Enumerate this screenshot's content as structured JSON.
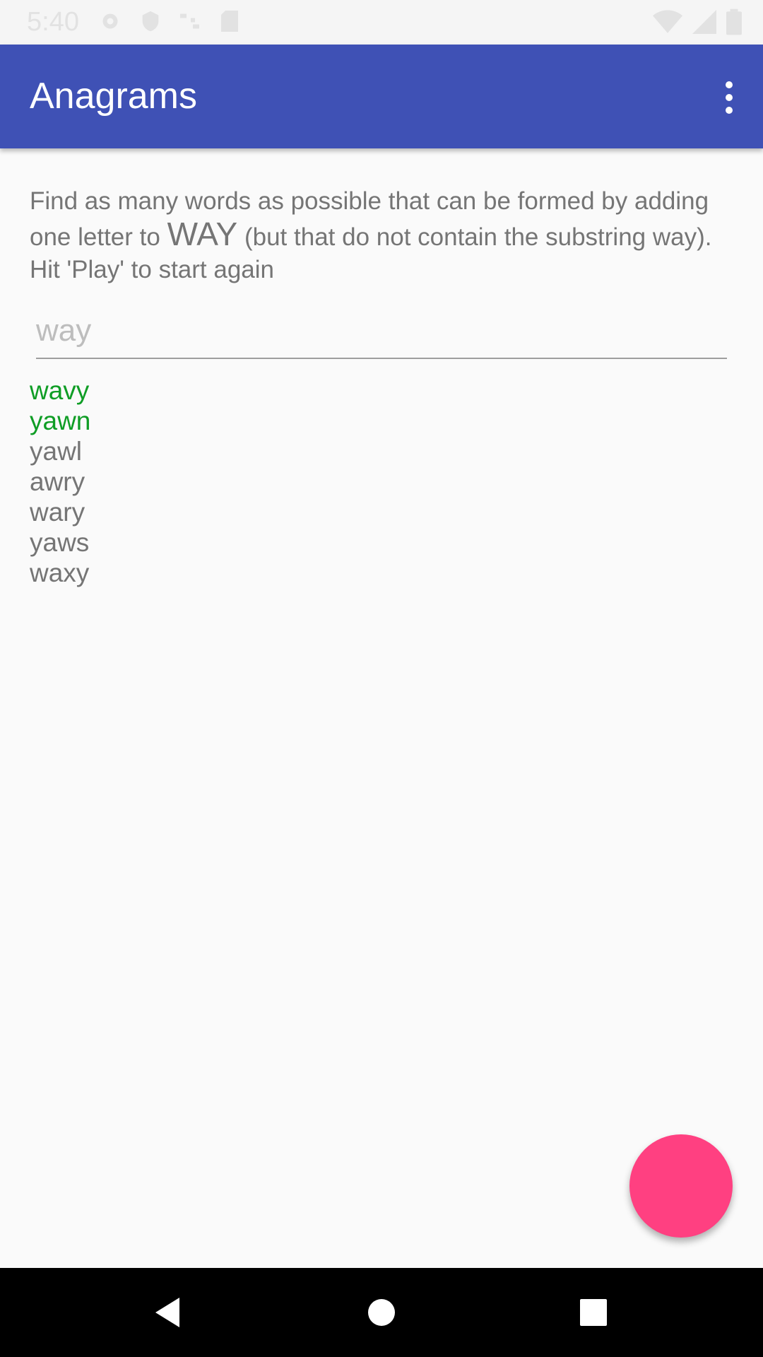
{
  "status_bar": {
    "time": "5:40",
    "icons_left": [
      "gear-icon",
      "shield-icon",
      "cast-icon",
      "sd-card-icon"
    ],
    "icons_right": [
      "wifi-icon",
      "signal-icon",
      "battery-icon"
    ]
  },
  "app_bar": {
    "title": "Anagrams",
    "color": "#3F51B5"
  },
  "instructions": {
    "part1": "Find as many words as possible that can be formed by adding one letter to ",
    "starter_word": "WAY",
    "part2": " (but that do not contain the substring way). Hit 'Play' to start again"
  },
  "input": {
    "placeholder": "way",
    "value": ""
  },
  "words": [
    {
      "text": "wavy",
      "status": "correct"
    },
    {
      "text": "yawn",
      "status": "correct"
    },
    {
      "text": "yawl",
      "status": "missed"
    },
    {
      "text": "awry",
      "status": "missed"
    },
    {
      "text": "wary",
      "status": "missed"
    },
    {
      "text": "yaws",
      "status": "missed"
    },
    {
      "text": "waxy",
      "status": "missed"
    }
  ],
  "colors": {
    "correct": "#0F9D25",
    "missed": "#757575",
    "fab": "#FF4081"
  },
  "nav_bar": {
    "icons": [
      "back-icon",
      "home-icon",
      "recents-icon"
    ]
  }
}
